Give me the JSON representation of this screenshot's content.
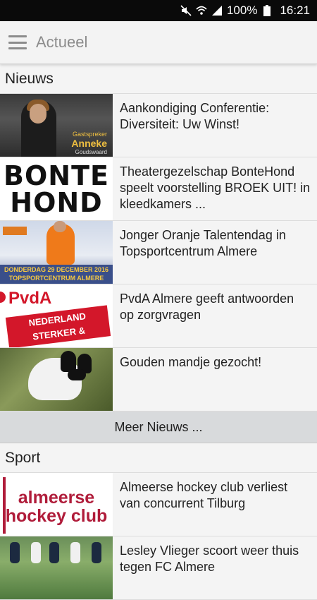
{
  "status_bar": {
    "battery_percent": "100%",
    "time": "16:21",
    "icons": [
      "mute-icon",
      "wifi-icon",
      "signal-icon",
      "battery-icon"
    ]
  },
  "app_bar": {
    "title": "Actueel",
    "menu_icon": "hamburger-menu-icon"
  },
  "news": {
    "header": "Nieuws",
    "items": [
      {
        "title": "Aankondiging Conferentie: Diversiteit: Uw Winst!",
        "thumb_caption": [
          "Gastspreker",
          "Anneke",
          "Goudswaard"
        ]
      },
      {
        "title": "Theatergezelschap BonteHond speelt voorstelling BROEK UIT! in kleedkamers ...",
        "thumb_caption": [
          "BONTE",
          "HOND"
        ]
      },
      {
        "title": "Jonger Oranje Talentendag in Topsportcentrum Almere",
        "thumb_caption": [
          "DONDERDAG 29 DECEMBER 2016",
          "TOPSPORTCENTRUM ALMERE"
        ]
      },
      {
        "title": "PvdA Almere geeft antwoorden op zorgvragen",
        "thumb_caption": [
          "PvdA",
          "NEDERLAND",
          "STERKER & SOCIALER"
        ]
      },
      {
        "title": "Gouden mandje gezocht!",
        "thumb_caption": []
      }
    ],
    "more_label": "Meer Nieuws ..."
  },
  "sport": {
    "header": "Sport",
    "items": [
      {
        "title": "Almeerse hockey club verliest van concurrent Tilburg",
        "thumb_caption": [
          "almeerse",
          "hockey club"
        ]
      },
      {
        "title": "Lesley Vlieger scoort weer thuis tegen FC Almere",
        "thumb_caption": []
      }
    ]
  },
  "colors": {
    "status_bar_bg": "#0a0a0a",
    "app_bar_bg": "#f3f3f3",
    "more_button_bg": "#d8dadc",
    "page_bg": "#f4f4f4"
  }
}
